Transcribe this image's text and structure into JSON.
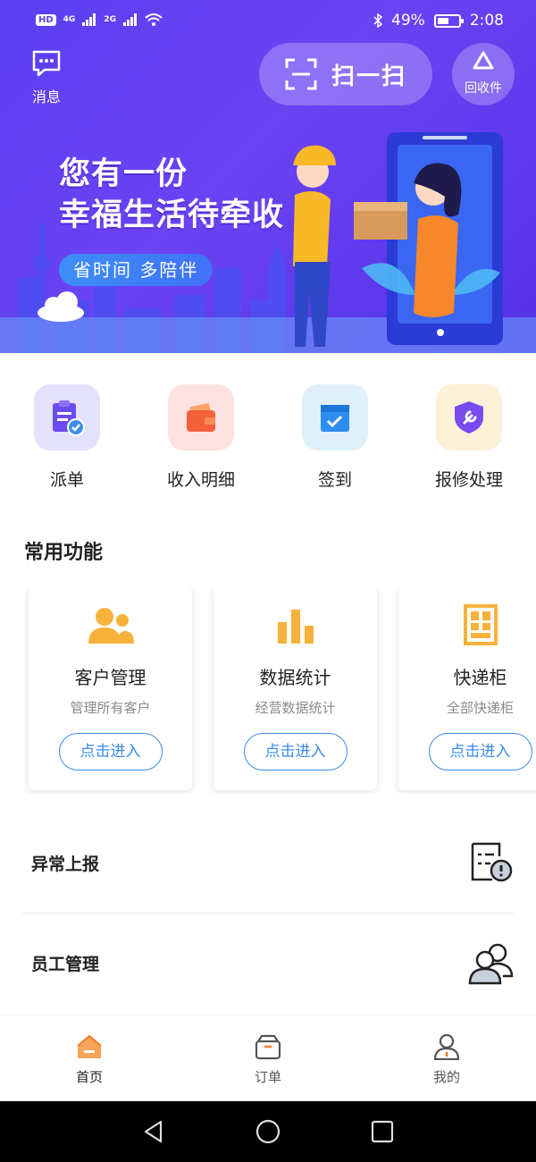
{
  "status_bar": {
    "hd": "HD",
    "network_1": "4G",
    "network_2": "2G",
    "battery": "49%",
    "time": "2:08"
  },
  "header": {
    "message_label": "消息",
    "scan_label": "扫一扫",
    "recycle_label": "回收件"
  },
  "banner": {
    "title_line1": "您有一份",
    "title_line2": "幸福生活待牵收",
    "tagline": "省时间 多陪伴"
  },
  "quick_actions": [
    {
      "label": "派单",
      "icon": "clipboard-check-icon",
      "bg": "#e4e1fb",
      "color": "#6a4cf0"
    },
    {
      "label": "收入明细",
      "icon": "wallet-icon",
      "bg": "#fde2e1",
      "color": "#f2603c"
    },
    {
      "label": "签到",
      "icon": "calendar-check-icon",
      "bg": "#dff0fb",
      "color": "#2e8ef0"
    },
    {
      "label": "报修处理",
      "icon": "wrench-shield-icon",
      "bg": "#fdf1d8",
      "color": "#7a4cf0"
    }
  ],
  "section": {
    "title": "常用功能"
  },
  "feature_cards": [
    {
      "title": "客户管理",
      "subtitle": "管理所有客户",
      "button": "点击进入",
      "icon": "users-icon"
    },
    {
      "title": "数据统计",
      "subtitle": "经营数据统计",
      "button": "点击进入",
      "icon": "bar-chart-icon"
    },
    {
      "title": "快递柜",
      "subtitle": "全部快递柜",
      "button": "点击进入",
      "icon": "locker-icon"
    }
  ],
  "list_rows": [
    {
      "label": "异常上报",
      "icon": "report-warning-icon"
    },
    {
      "label": "员工管理",
      "icon": "staff-icon"
    }
  ],
  "tab_bar": [
    {
      "label": "首页",
      "icon": "home-icon",
      "active": true
    },
    {
      "label": "订单",
      "icon": "box-icon",
      "active": false
    },
    {
      "label": "我的",
      "icon": "user-icon",
      "active": false
    }
  ],
  "colors": {
    "brand_purple": "#5b3ff0",
    "accent_blue": "#3b8bea",
    "icon_orange": "#f7b23b"
  }
}
